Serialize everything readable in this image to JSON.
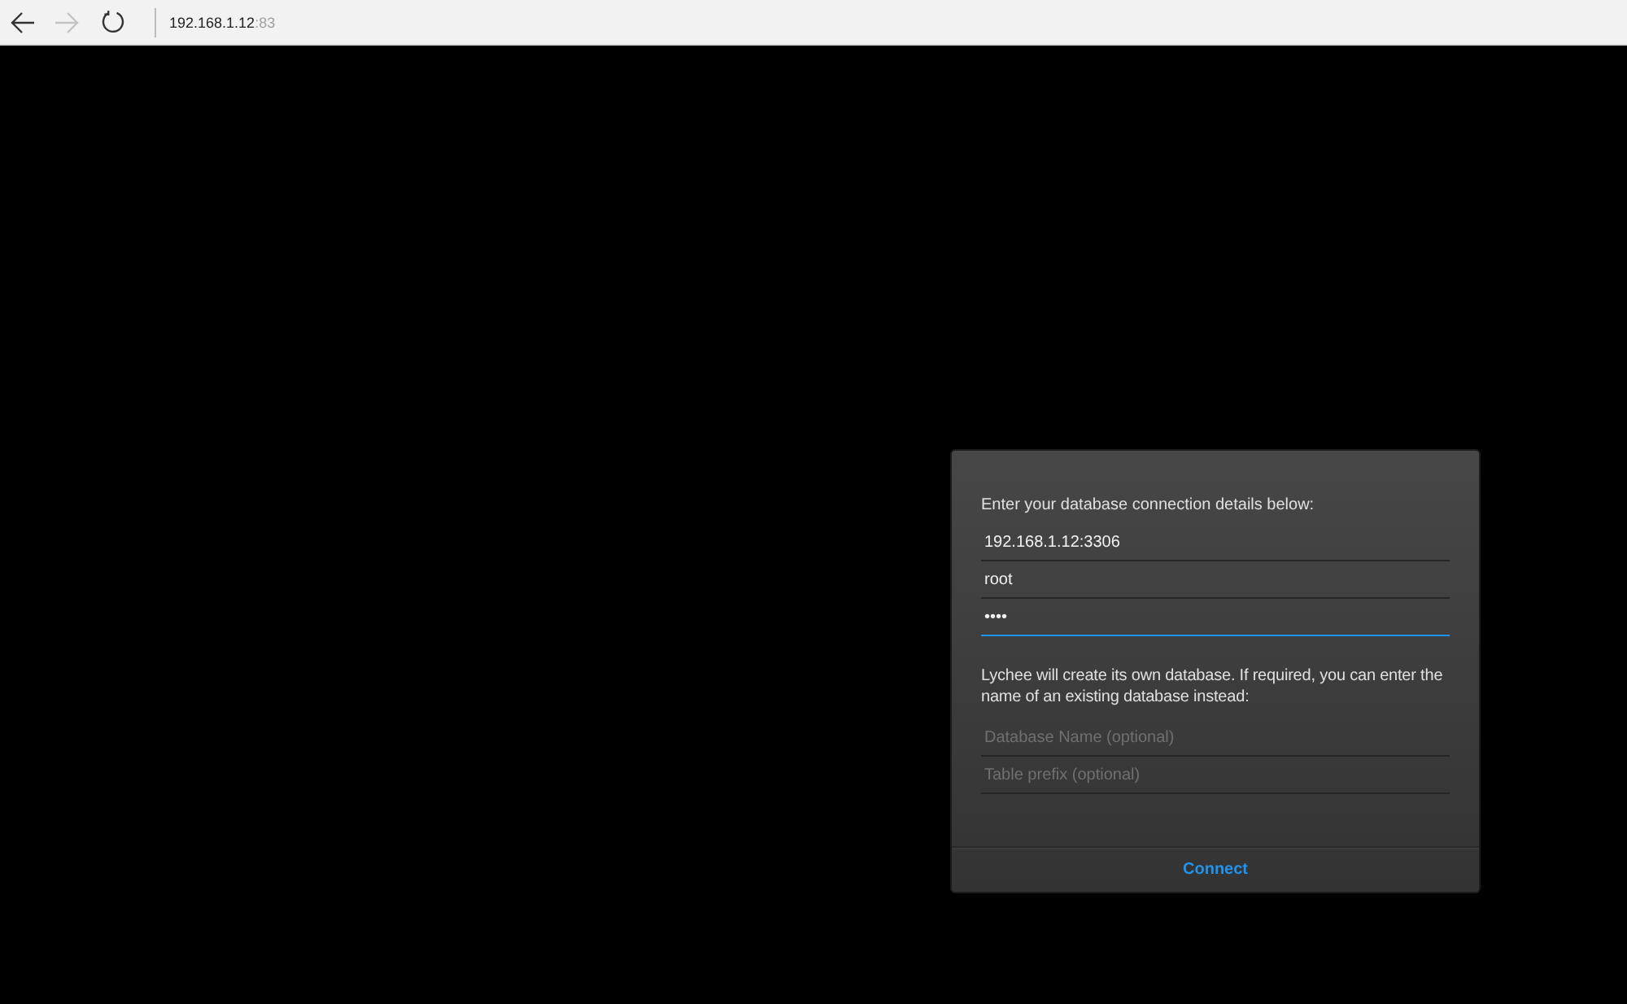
{
  "browser": {
    "back": {
      "disabled": false
    },
    "forward": {
      "disabled": true
    },
    "address": {
      "host": "192.168.1.12",
      "port": ":83"
    }
  },
  "dialog": {
    "intro": "Enter your database connection details below:",
    "connection_fields": [
      {
        "value": "192.168.1.12:3306",
        "focused": false
      },
      {
        "value": "root",
        "focused": false
      },
      {
        "value": "••••",
        "focused": true
      }
    ],
    "note": "Lychee will create its own database. If required, you can enter the name of an existing database instead:",
    "database_fields": [
      {
        "placeholder": "Database Name (optional)",
        "focused": false
      },
      {
        "placeholder": "Table prefix (optional)",
        "focused": false
      }
    ],
    "button": "Connect"
  }
}
